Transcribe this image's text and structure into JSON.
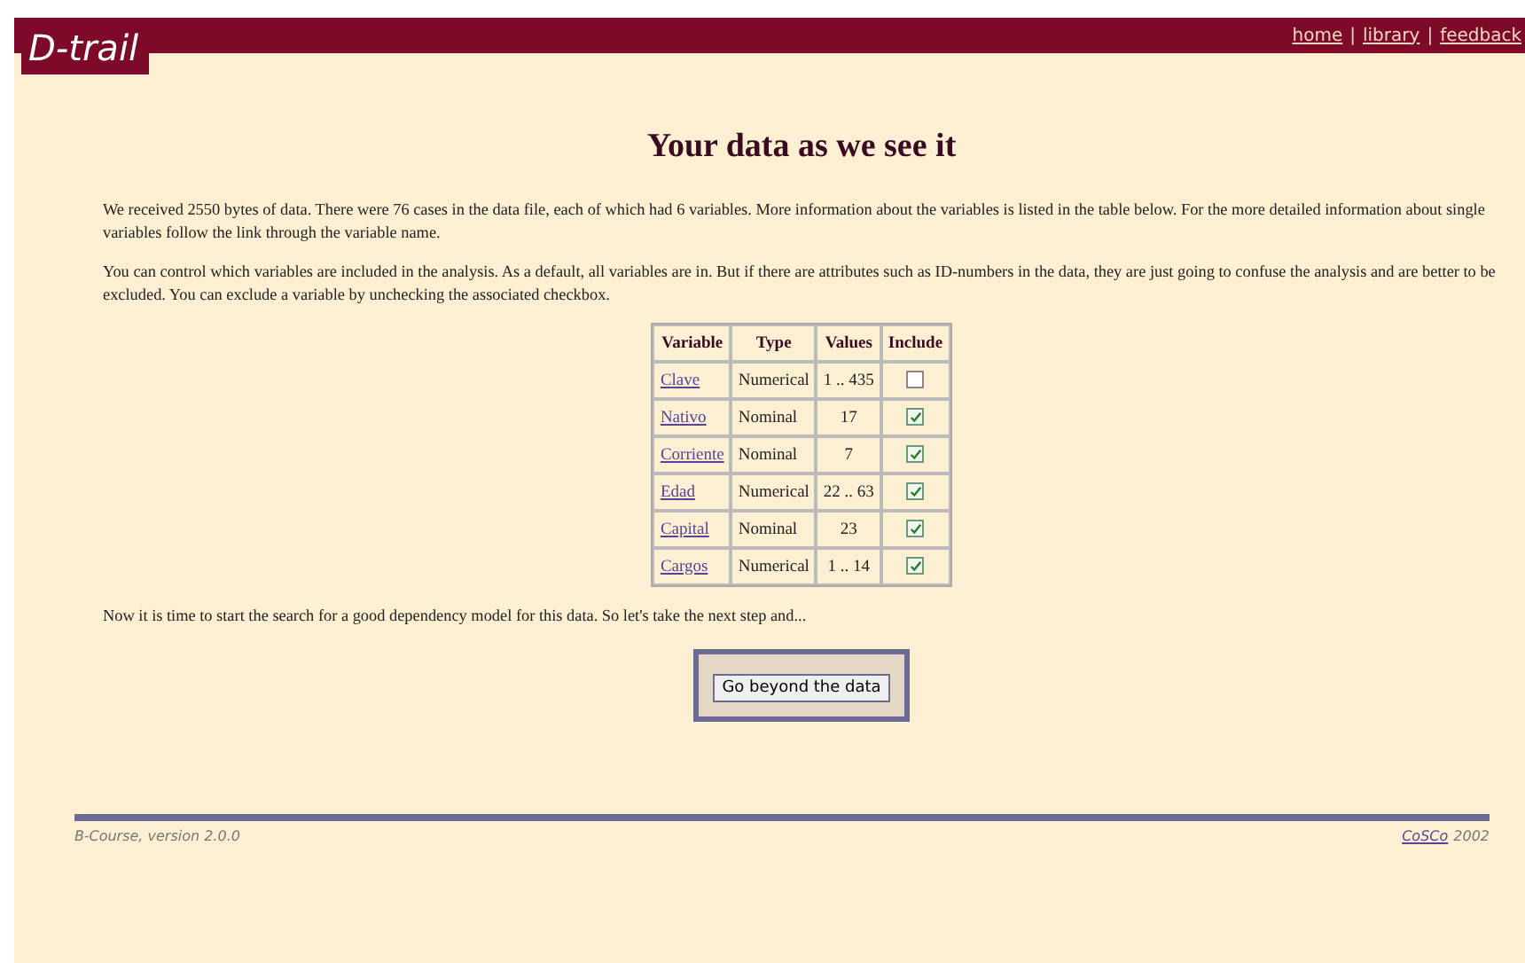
{
  "logo": {
    "text": "D-trail"
  },
  "nav_links": [
    "home",
    "library",
    "feedback"
  ],
  "nav_separator": "|",
  "title": "Your data as we see it",
  "paragraphs": [
    "We received 2550 bytes of data. There were 76 cases in the data file, each of which had 6 variables. More information about the variables is listed in the table below. For the more detailed information about single variables follow the link through the variable name.",
    "You can control which variables are included in the analysis. As a default, all variables are in. But if there are attributes such as ID-numbers in the data, they are just going to confuse the analysis and are better to be excluded. You can exclude a variable by unchecking the associated checkbox."
  ],
  "table": {
    "columns": [
      "Variable",
      "Type",
      "Values",
      "Include"
    ],
    "rows": [
      {
        "variable": "Clave",
        "type": "Numerical",
        "values": "1 .. 435",
        "checked": false
      },
      {
        "variable": "Nativo",
        "type": "Nominal",
        "values": "17",
        "checked": true
      },
      {
        "variable": "Corriente",
        "type": "Nominal",
        "values": "7",
        "checked": true
      },
      {
        "variable": "Edad",
        "type": "Numerical",
        "values": "22 .. 63",
        "checked": true
      },
      {
        "variable": "Capital",
        "type": "Nominal",
        "values": "23",
        "checked": true
      },
      {
        "variable": "Cargos",
        "type": "Numerical",
        "values": "1 .. 14",
        "checked": true
      }
    ]
  },
  "next_text": "Now it is time to start the search for a good dependency model for this data. So let's take the next step and...",
  "button": "Go beyond the data",
  "footer": {
    "version": "B-Course, version 2.0.0",
    "link": "CoSCo",
    "year": "2002"
  }
}
